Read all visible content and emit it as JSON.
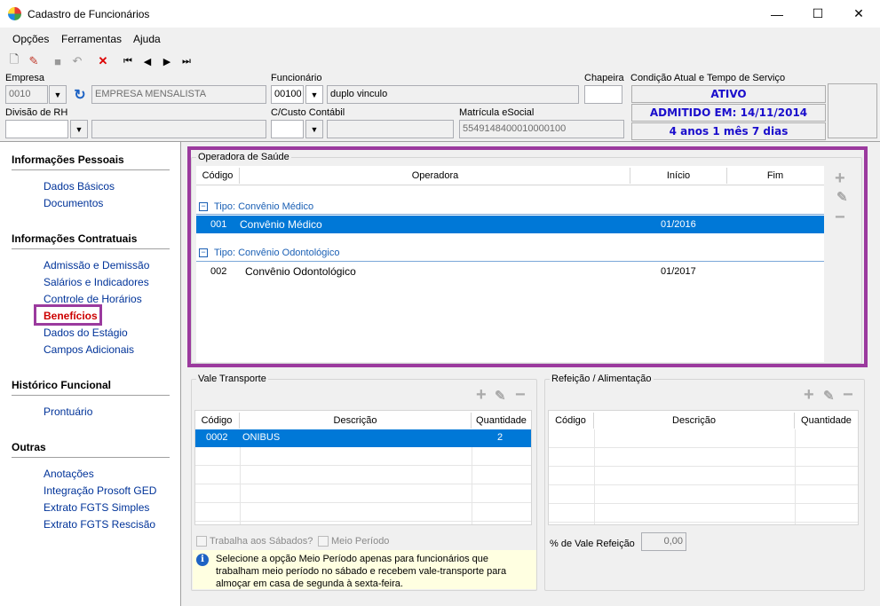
{
  "window": {
    "title": "Cadastro de Funcionários",
    "min": "—",
    "max": "☐",
    "close": "✕"
  },
  "menu": [
    "Opções",
    "Ferramentas",
    "Ajuda"
  ],
  "toolbar": {
    "new": "🗋",
    "edit": "✎",
    "save": "■",
    "undo": "↶",
    "delete": "✕",
    "first": "⏮",
    "prev": "◀",
    "next": "▶",
    "last": "⏭"
  },
  "header": {
    "empresa_label": "Empresa",
    "empresa_code": "0010",
    "empresa_name": "EMPRESA MENSALISTA",
    "funcionario_label": "Funcionário",
    "funcionario_code": "00100",
    "funcionario_name": "duplo vinculo",
    "chapeira_label": "Chapeira",
    "chapeira_value": "",
    "divisao_label": "Divisão de RH",
    "divisao_value": "",
    "custo_label": "C/Custo Contábil",
    "custo_value": "",
    "matricula_label": "Matrícula eSocial",
    "matricula_value": "5549148400010000100",
    "condicao_label": "Condição Atual e Tempo de Serviço",
    "status": "ATIVO",
    "admitido": "ADMITIDO EM: 14/11/2014",
    "tempo": "4 anos 1 mês 7 dias"
  },
  "sidebar": {
    "sections": [
      {
        "title": "Informações Pessoais",
        "items": [
          "Dados Básicos",
          "Documentos"
        ]
      },
      {
        "title": "Informações Contratuais",
        "items": [
          "Admissão e Demissão",
          "Salários e Indicadores",
          "Controle de Horários",
          "Benefícios",
          "Dados do Estágio",
          "Campos Adicionais"
        ]
      },
      {
        "title": "Histórico Funcional",
        "items": [
          "Prontuário"
        ]
      },
      {
        "title": "Outras",
        "items": [
          "Anotações",
          "Integração Prosoft GED",
          "Extrato FGTS Simples",
          "Extrato FGTS Rescisão"
        ]
      }
    ]
  },
  "operadora": {
    "title": "Operadora de Saúde",
    "columns": [
      "Código",
      "Operadora",
      "Início",
      "Fim"
    ],
    "groups": [
      {
        "label": "Tipo: Convênio Médico",
        "rows": [
          {
            "codigo": "001",
            "operadora": "Convênio Médico",
            "inicio": "01/2016",
            "fim": ""
          }
        ]
      },
      {
        "label": "Tipo: Convênio Odontológico",
        "rows": [
          {
            "codigo": "002",
            "operadora": "Convênio Odontológico",
            "inicio": "01/2017",
            "fim": ""
          }
        ]
      }
    ]
  },
  "vale": {
    "title": "Vale Transporte",
    "columns": [
      "Código",
      "Descrição",
      "Quantidade"
    ],
    "rows": [
      {
        "codigo": "0002",
        "descricao": "ONIBUS",
        "quantidade": "2"
      }
    ],
    "sabados_label": "Trabalha aos Sábados?",
    "meio_label": "Meio Período",
    "info": "Selecione a opção Meio Período apenas para funcionários que trabalham meio período no sábado e recebem vale-transporte para almoçar em casa de segunda à sexta-feira."
  },
  "refeicao": {
    "title": "Refeição / Alimentação",
    "columns": [
      "Código",
      "Descrição",
      "Quantidade"
    ],
    "pct_label": "% de Vale Refeição",
    "pct_value": "0,00"
  }
}
